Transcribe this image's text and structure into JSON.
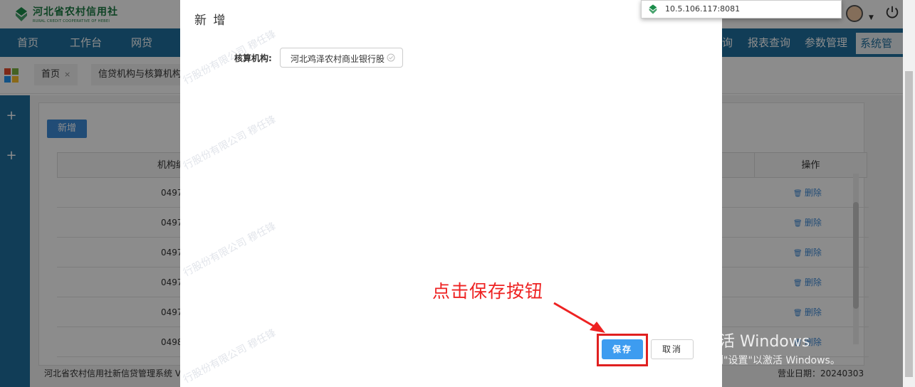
{
  "header": {
    "logo_cn": "河北省农村信用社",
    "logo_en": "RURAL CREDIT COOPERATIVE OF HEBEI"
  },
  "nav": {
    "items": [
      "首页",
      "工作台",
      "网贷",
      "询",
      "报表查询",
      "参数管理",
      "系统管理"
    ],
    "active": "系统管理"
  },
  "tabs": [
    {
      "label": "首页",
      "close": "×"
    },
    {
      "label": "信贷机构与核算机构"
    }
  ],
  "sidebar": {
    "plus_icons": [
      "+",
      "+"
    ]
  },
  "content": {
    "add_button": "新增",
    "columns": {
      "code": "机构编",
      "action": "操作"
    },
    "rows": [
      {
        "code": "0497",
        "action": "删除"
      },
      {
        "code": "0497",
        "action": "删除"
      },
      {
        "code": "0497",
        "action": "删除"
      },
      {
        "code": "0497",
        "action": "删除"
      },
      {
        "code": "0497",
        "action": "删除"
      },
      {
        "code": "0498",
        "action": "删除"
      }
    ]
  },
  "footer": {
    "system_name": "河北省农村信用社新信贷管理系统 V",
    "business_date": "营业日期：20240303"
  },
  "modal": {
    "title": "新 增",
    "field_label": "核算机构:",
    "field_value": "河北鸡泽农村商业银行股",
    "save_label": "保存",
    "cancel_label": "取消"
  },
  "annotation": {
    "text": "点击保存按钮",
    "color": "#ee2222"
  },
  "url_tooltip": {
    "url": "10.5.106.117:8081"
  },
  "watermark": {
    "text": "行股份有限公司 穆任锋"
  },
  "windows_activation": {
    "line1": "激活 Windows",
    "line2": "转到\"设置\"以激活 Windows。"
  },
  "colors": {
    "nav_blue": "#1f6f9e",
    "primary_button": "#3d9cf0",
    "highlight_red": "#e02020",
    "link_blue": "#3d8ad8"
  }
}
